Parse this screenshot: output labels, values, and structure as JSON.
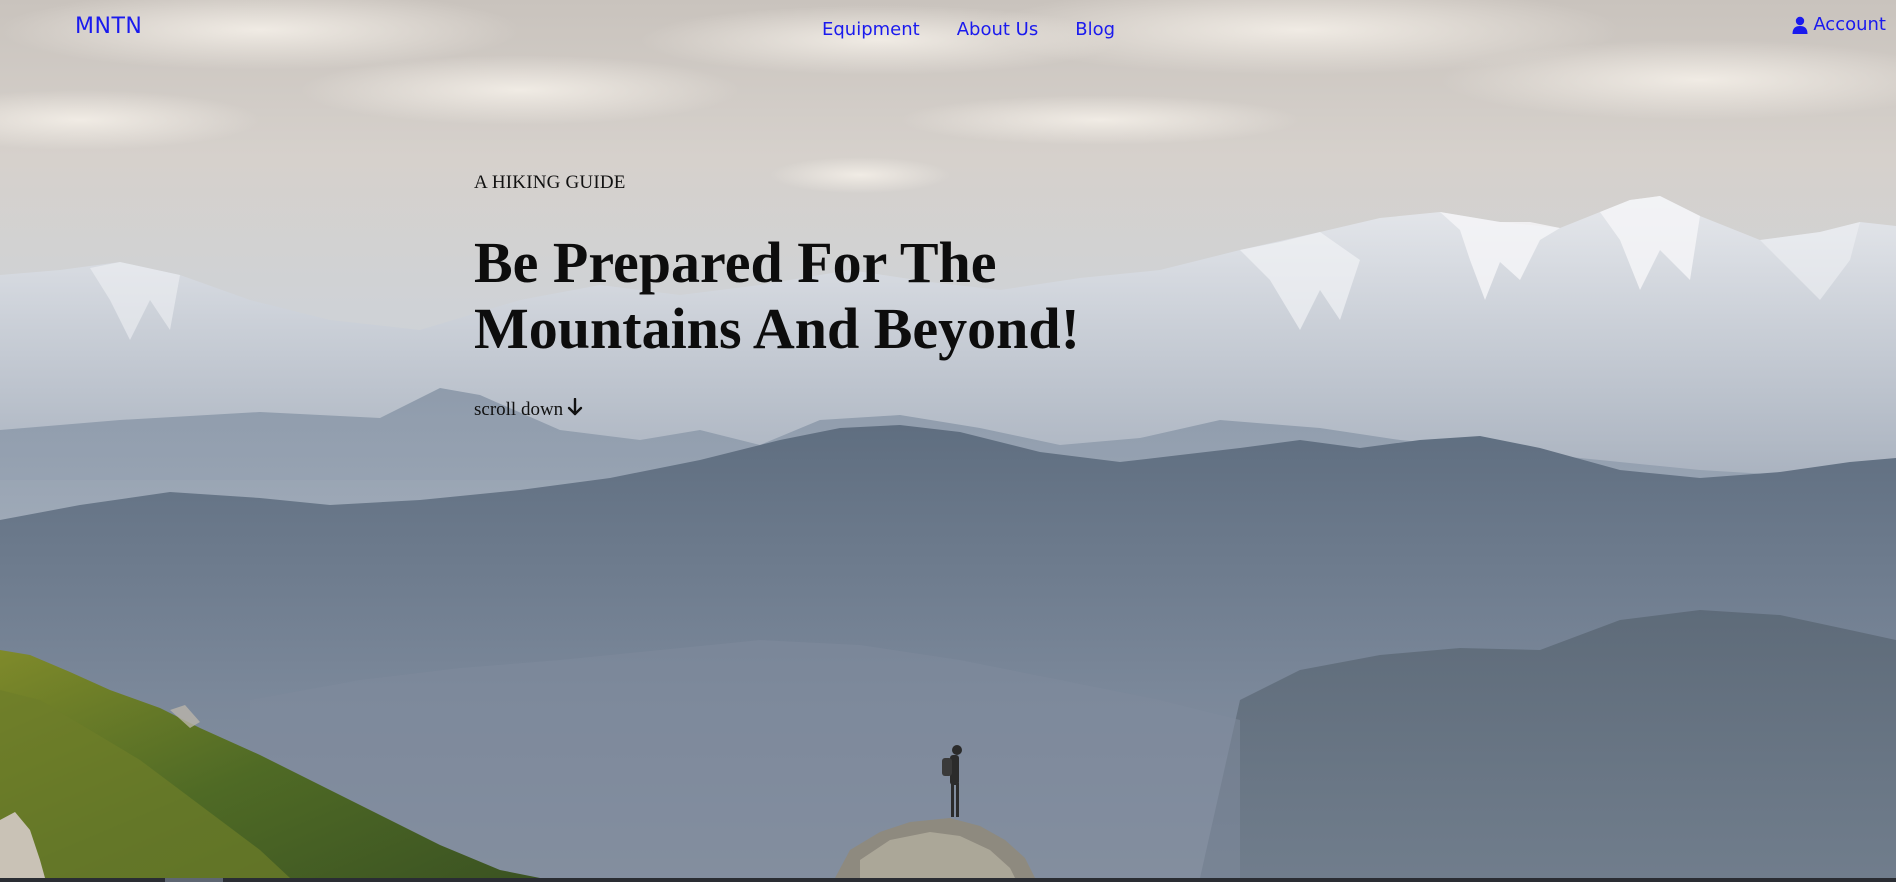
{
  "brand": {
    "logo": "MNTN",
    "link_color": "#1a1aee"
  },
  "nav": {
    "items": [
      "Equipment",
      "About Us",
      "Blog"
    ]
  },
  "account": {
    "label": "Account",
    "icon": "user-icon"
  },
  "hero": {
    "eyebrow": "A HIKING GUIDE",
    "headline_line1": "Be Prepared For The",
    "headline_line2": "Mountains And Beyond!",
    "scroll_label": "scroll down",
    "scroll_icon": "arrow-down-icon",
    "background": "mountain-landscape-photo"
  }
}
